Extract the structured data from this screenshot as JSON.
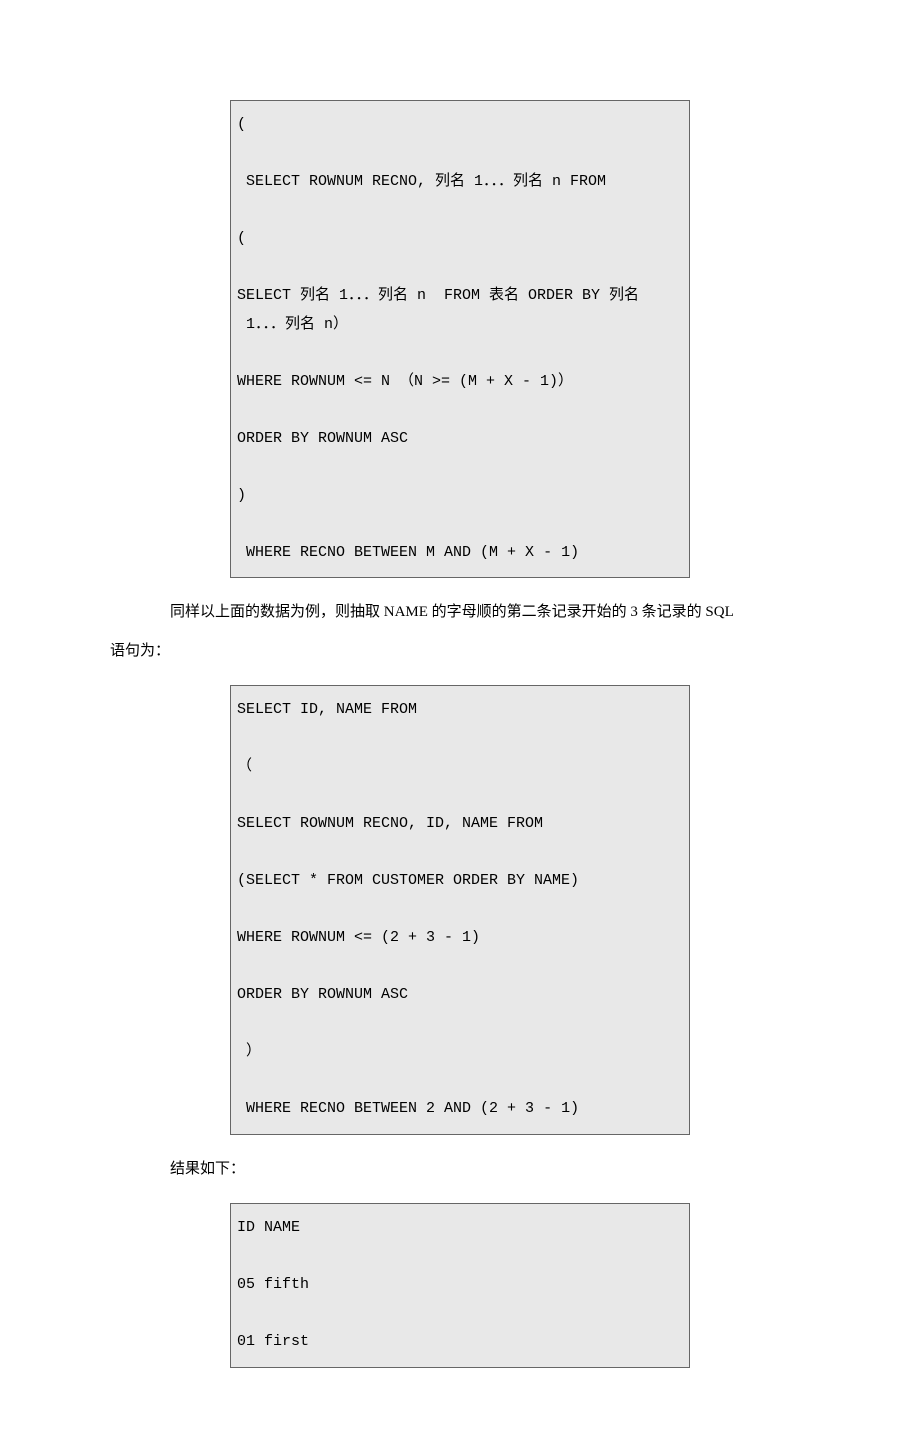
{
  "codeBlock1": "(\n\n SELECT ROWNUM RECNO, 列名 1．．．列名 n FROM\n\n(\n\nSELECT 列名 1．．．列名 n  FROM 表名 ORDER BY 列名\n 1．．．列名 n）\n\nWHERE ROWNUM <= N （N >= (M + X - 1)）\n\nORDER BY ROWNUM ASC\n\n)\n\n WHERE RECNO BETWEEN M AND (M + X - 1)",
  "paragraph1_line1": "同样以上面的数据为例，则抽取 NAME 的字母顺的第二条记录开始的 3 条记录的 SQL",
  "paragraph1_line2": "语句为：",
  "codeBlock2": "SELECT ID, NAME FROM\n\n（\n\nSELECT ROWNUM RECNO, ID, NAME FROM\n\n(SELECT * FROM CUSTOMER ORDER BY NAME)\n\nWHERE ROWNUM <= (2 + 3 - 1)\n\nORDER BY ROWNUM ASC\n\n ）\n\n WHERE RECNO BETWEEN 2 AND (2 + 3 - 1)",
  "paragraph2": "结果如下：",
  "codeBlock3": "ID NAME\n\n05 fifth\n\n01 first\n"
}
